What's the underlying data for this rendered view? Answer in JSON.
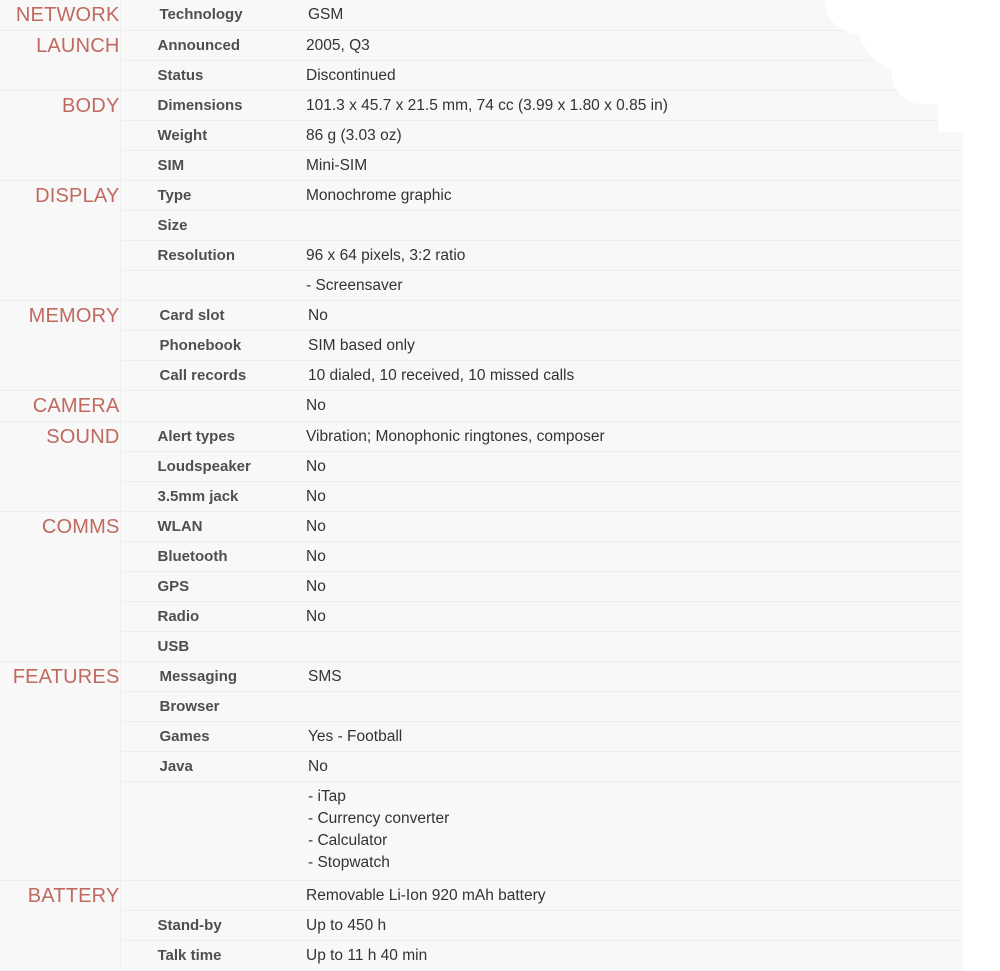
{
  "page": {
    "title": "Phone specifications sheet",
    "header_color": "#c0695e",
    "label_color": "#4f4f4f",
    "value_color": "#333333",
    "row_background": "#f8f8f8",
    "section_column_background": "#f6f6f6"
  },
  "sections": [
    {
      "name": "NETWORK",
      "indent": "deep",
      "rows": [
        {
          "label": "Technology",
          "value": "GSM"
        }
      ]
    },
    {
      "name": "LAUNCH",
      "indent": "normal",
      "rows": [
        {
          "label": "Announced",
          "value": "2005, Q3"
        },
        {
          "label": "Status",
          "value": "Discontinued"
        }
      ]
    },
    {
      "name": "BODY",
      "indent": "normal",
      "rows": [
        {
          "label": "Dimensions",
          "value": "101.3 x 45.7 x 21.5 mm, 74 cc (3.99 x 1.80 x 0.85 in)"
        },
        {
          "label": "Weight",
          "value": "86 g (3.03 oz)"
        },
        {
          "label": "SIM",
          "value": "Mini-SIM"
        }
      ]
    },
    {
      "name": "DISPLAY",
      "indent": "normal",
      "rows": [
        {
          "label": "Type",
          "value": "Monochrome graphic"
        },
        {
          "label": "Size",
          "value": ""
        },
        {
          "label": "Resolution",
          "value": "96 x 64 pixels, 3:2 ratio"
        },
        {
          "label": "",
          "value": "- Screensaver"
        }
      ]
    },
    {
      "name": "MEMORY",
      "indent": "deep",
      "rows": [
        {
          "label": "Card slot",
          "value": "No"
        },
        {
          "label": "Phonebook",
          "value": "SIM based only"
        },
        {
          "label": "Call records",
          "value": "10 dialed, 10 received, 10 missed calls"
        }
      ]
    },
    {
      "name": "CAMERA",
      "indent": "normal",
      "rows": [
        {
          "label": "",
          "value": "No"
        }
      ]
    },
    {
      "name": "SOUND",
      "indent": "normal",
      "rows": [
        {
          "label": "Alert types",
          "value": "Vibration; Monophonic ringtones, composer"
        },
        {
          "label": "Loudspeaker",
          "value": "No"
        },
        {
          "label": "3.5mm jack",
          "value": "No"
        }
      ]
    },
    {
      "name": "COMMS",
      "indent": "normal",
      "rows": [
        {
          "label": "WLAN",
          "value": "No"
        },
        {
          "label": "Bluetooth",
          "value": "No"
        },
        {
          "label": "GPS",
          "value": "No"
        },
        {
          "label": "Radio",
          "value": "No"
        },
        {
          "label": "USB",
          "value": ""
        }
      ]
    },
    {
      "name": "FEATURES",
      "indent": "deep",
      "rows": [
        {
          "label": "Messaging",
          "value": "SMS"
        },
        {
          "label": "Browser",
          "value": ""
        },
        {
          "label": "Games",
          "value": "Yes - Football"
        },
        {
          "label": "Java",
          "value": "No"
        },
        {
          "label": "",
          "value": "",
          "bullets": [
            "- iTap",
            "- Currency converter",
            "- Calculator",
            "- Stopwatch"
          ]
        }
      ]
    },
    {
      "name": "BATTERY",
      "indent": "normal",
      "rows": [
        {
          "label": "",
          "value": "Removable Li-Ion 920 mAh battery"
        },
        {
          "label": "Stand-by",
          "value": "Up to 450 h"
        },
        {
          "label": "Talk time",
          "value": "Up to 11 h 40 min"
        }
      ]
    }
  ]
}
